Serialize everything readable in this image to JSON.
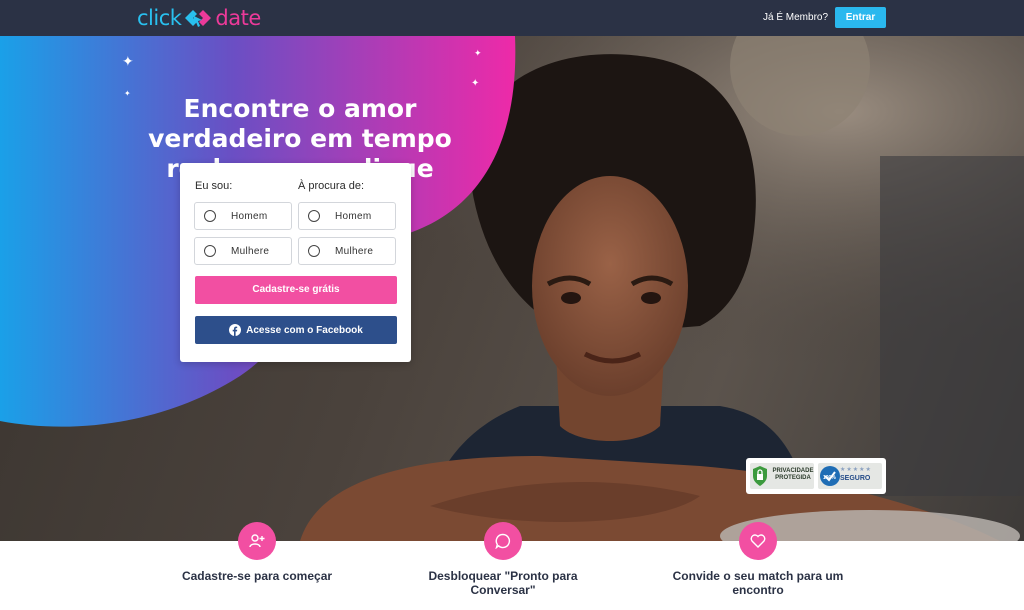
{
  "header": {
    "logo_left": "click",
    "logo_right": "date",
    "member_text": "Já É Membro?",
    "login_label": "Entrar"
  },
  "hero": {
    "headline": "Encontre o amor verdadeiro em tempo real com um clique"
  },
  "form": {
    "i_am_label": "Eu sou:",
    "seeking_label": "À procura de:",
    "i_am_options": [
      "Homem",
      "Mulhere"
    ],
    "seeking_options": [
      "Homem",
      "Mulhere"
    ],
    "signup_label": "Cadastre-se grátis",
    "facebook_label": "Acesse com o Facebook"
  },
  "badges": {
    "privacy": "PRIVACIDADE PROTEGIDA",
    "secure_percent": "100%",
    "secure": "SEGURO"
  },
  "features": [
    {
      "label": "Cadastre-se para começar",
      "icon": "add-user-icon"
    },
    {
      "label": "Desbloquear \"Pronto para Conversar\"",
      "icon": "chat-bubble-icon"
    },
    {
      "label": "Convide o seu match para um encontro",
      "icon": "heart-icon"
    }
  ],
  "colors": {
    "topbar": "#2b3245",
    "accent_blue": "#2ab8ee",
    "accent_pink": "#f24fa2",
    "facebook": "#2d4f8b"
  }
}
